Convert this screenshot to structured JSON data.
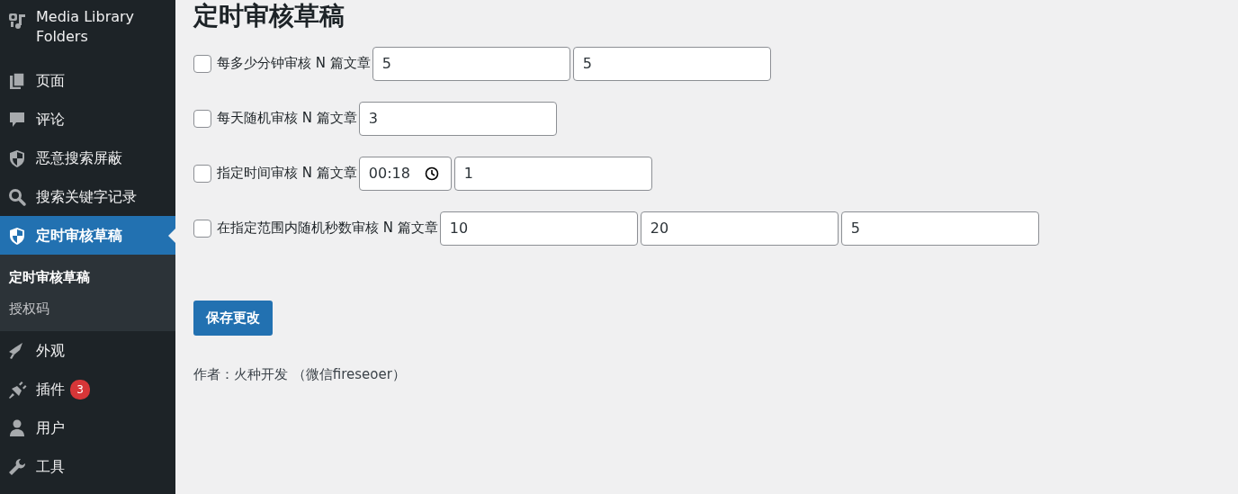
{
  "sidebar": {
    "items": [
      {
        "label": "Media Library Folders",
        "selected": false
      },
      {
        "label": "页面",
        "selected": false
      },
      {
        "label": "评论",
        "selected": false
      },
      {
        "label": "恶意搜索屏蔽",
        "selected": false
      },
      {
        "label": "搜索关键字记录",
        "selected": false
      },
      {
        "label": "定时审核草稿",
        "selected": true,
        "submenu": [
          {
            "label": "定时审核草稿",
            "selected": true
          },
          {
            "label": "授权码",
            "selected": false
          }
        ]
      },
      {
        "label": "外观",
        "selected": false
      },
      {
        "label": "插件",
        "selected": false,
        "badge": "3"
      },
      {
        "label": "用户",
        "selected": false
      },
      {
        "label": "工具",
        "selected": false
      }
    ]
  },
  "page_title": "定时审核草稿",
  "options": [
    {
      "checked": false,
      "label": "每多少分钟审核 N 篇文章",
      "fields": [
        {
          "kind": "text",
          "value": "5"
        },
        {
          "kind": "text",
          "value": "5"
        }
      ]
    },
    {
      "checked": false,
      "label": "每天随机审核 N 篇文章",
      "fields": [
        {
          "kind": "text",
          "value": "3"
        }
      ]
    },
    {
      "checked": false,
      "label": "指定时间审核 N 篇文章",
      "fields": [
        {
          "kind": "time",
          "value": "00:18"
        },
        {
          "kind": "text",
          "value": "1"
        }
      ]
    },
    {
      "checked": false,
      "label": "在指定范围内随机秒数审核 N 篇文章",
      "fields": [
        {
          "kind": "text",
          "value": "10"
        },
        {
          "kind": "text",
          "value": "20"
        },
        {
          "kind": "text",
          "value": "5"
        }
      ]
    }
  ],
  "save_button": "保存更改",
  "footer": "作者：火种开发 （微信fireseoer）"
}
